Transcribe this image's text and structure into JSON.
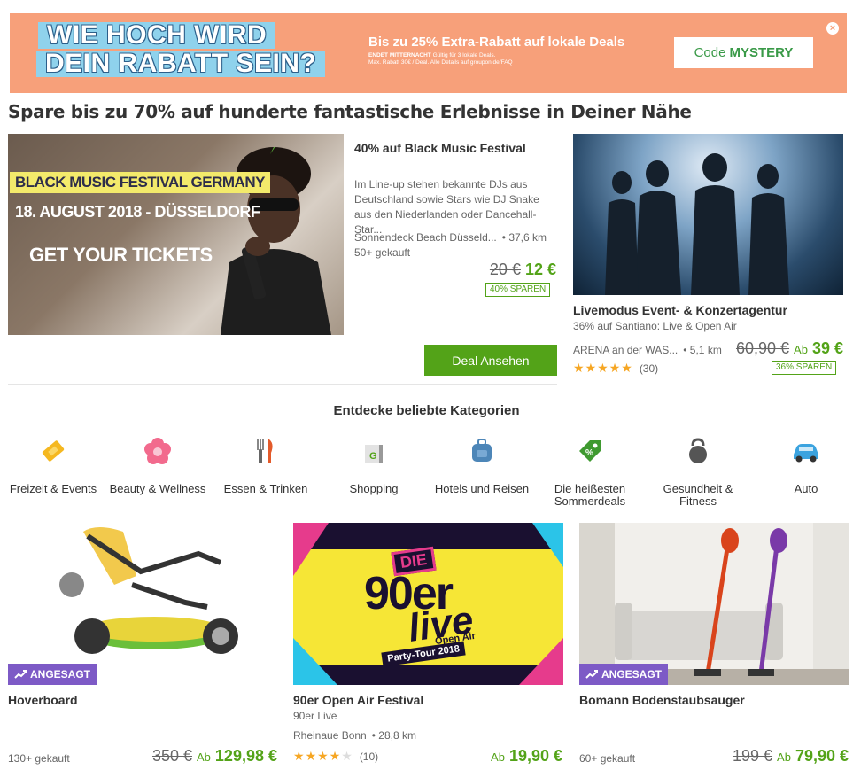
{
  "banner": {
    "headline_line1": "WIE HOCH WIRD",
    "headline_line2": "DEIN RABATT SEIN?",
    "promo_title": "Bis zu 25% Extra-Rabatt auf lokale Deals",
    "promo_ends": "ENDET MITTERNACHT",
    "promo_ends_note": "Gültig für 3 lokale Deals.",
    "promo_fineprint": "Max. Rabatt 30€ / Deal. Alle Details auf groupon.de/FAQ",
    "code_label": "Code",
    "code_value": "MYSTERY",
    "close": "×"
  },
  "page_title": "Spare bis zu 70% auf hunderte fantastische Erlebnisse in Deiner Nähe",
  "featured": {
    "image_text_line1": "BLACK MUSIC FESTIVAL GERMANY",
    "image_text_line2": "18. AUGUST 2018 - DÜSSELDORF",
    "image_text_line3": "GET YOUR TICKETS",
    "title": "40% auf Black Music Festival",
    "description": "Im Line-up stehen bekannte DJs aus Deutschland sowie Stars wie DJ Snake aus den Niederlanden oder Dancehall-Star...",
    "location": "Sonnendeck Beach Düsseld...",
    "distance": "• 37,6 km",
    "bought": "50+ gekauft",
    "old_price": "20 €",
    "new_price": "12 €",
    "save": "40% SPAREN",
    "button": "Deal Ansehen"
  },
  "side_deal": {
    "title": "Livemodus Event- & Konzertagentur",
    "subtitle": "36% auf Santiano: Live & Open Air",
    "location": "ARENA an der WAS...",
    "distance": "• 5,1 km",
    "old_price": "60,90 €",
    "ab": "Ab",
    "new_price": "39 €",
    "rating": 4.5,
    "reviews": "(30)",
    "save": "36% SPAREN"
  },
  "categories_title": "Entdecke beliebte Kategorien",
  "categories": [
    {
      "label": "Freizeit & Events",
      "icon": "ticket-icon",
      "color": "#f5b820"
    },
    {
      "label": "Beauty & Wellness",
      "icon": "flower-icon",
      "color": "#f26a8d"
    },
    {
      "label": "Essen & Trinken",
      "icon": "cutlery-icon",
      "color": "#888888"
    },
    {
      "label": "Shopping",
      "icon": "shopping-bag-icon",
      "color": "#53a318"
    },
    {
      "label": "Hotels und Reisen",
      "icon": "luggage-icon",
      "color": "#4d86b8"
    },
    {
      "label": "Die heißesten Sommerdeals",
      "icon": "price-tag-icon",
      "color": "#3f9a30"
    },
    {
      "label": "Gesundheit & Fitness",
      "icon": "kettlebell-icon",
      "color": "#555555"
    },
    {
      "label": "Auto",
      "icon": "car-icon",
      "color": "#3ba3df"
    }
  ],
  "cards": [
    {
      "badge": "ANGESAGT",
      "title": "Hoverboard",
      "bought": "130+ gekauft",
      "old_price": "350 €",
      "ab": "Ab",
      "new_price": "129,98 €"
    },
    {
      "image_text_line1": "DIE",
      "image_text_line2": "90er",
      "image_text_line3": "live",
      "image_text_line4": "Open Air",
      "image_text_line5": "Party-Tour 2018",
      "title": "90er Open Air Festival",
      "subtitle": "90er Live",
      "location": "Rheinaue Bonn",
      "distance": "• 28,8 km",
      "rating": 3.5,
      "reviews": "(10)",
      "ab": "Ab",
      "new_price": "19,90 €"
    },
    {
      "badge": "ANGESAGT",
      "title": "Bomann Bodenstaubsauger",
      "bought": "60+ gekauft",
      "old_price": "199 €",
      "ab": "Ab",
      "new_price": "79,90 €"
    }
  ]
}
